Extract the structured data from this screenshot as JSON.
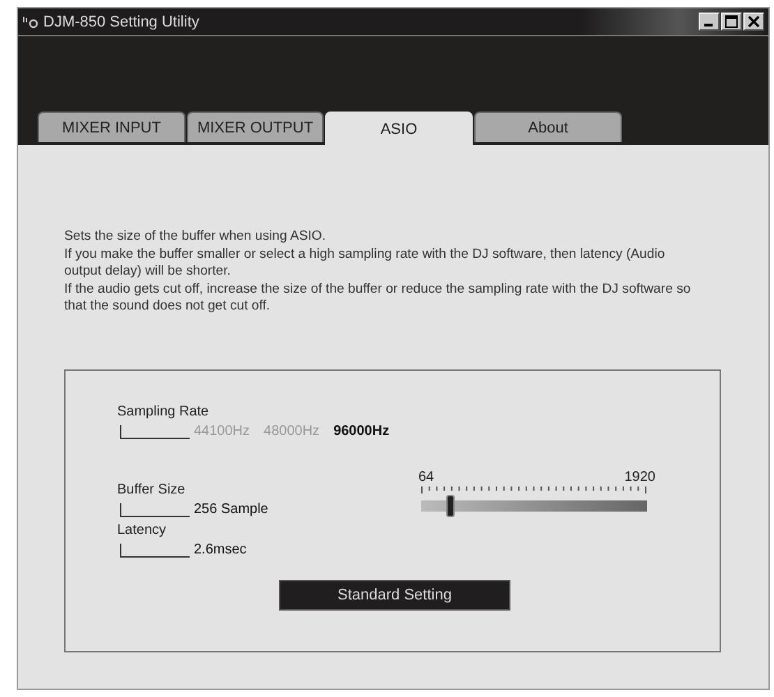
{
  "window": {
    "title": "DJM-850 Setting Utility"
  },
  "tabs": [
    {
      "label": "MIXER INPUT",
      "selected": false
    },
    {
      "label": "MIXER OUTPUT",
      "selected": false
    },
    {
      "label": "ASIO",
      "selected": true
    },
    {
      "label": "About",
      "selected": false
    }
  ],
  "description": [
    "Sets the size of the buffer when using ASIO.",
    "If you make the buffer smaller or select a high sampling rate with the DJ software, then latency (Audio output delay) will be shorter.",
    "If the audio gets cut off, increase the size of the buffer or reduce the sampling rate with the DJ software so that the sound does not get cut off."
  ],
  "sampling_rate": {
    "label": "Sampling Rate",
    "options": [
      {
        "label": "44100Hz",
        "selected": false
      },
      {
        "label": "48000Hz",
        "selected": false
      },
      {
        "label": "96000Hz",
        "selected": true
      }
    ]
  },
  "buffer_size": {
    "label": "Buffer Size",
    "value": "256 Sample",
    "min_label": "64",
    "max_label": "1920",
    "level": 0.11
  },
  "latency": {
    "label": "Latency",
    "value": "2.6msec"
  },
  "buttons": [
    "Standard Setting"
  ]
}
